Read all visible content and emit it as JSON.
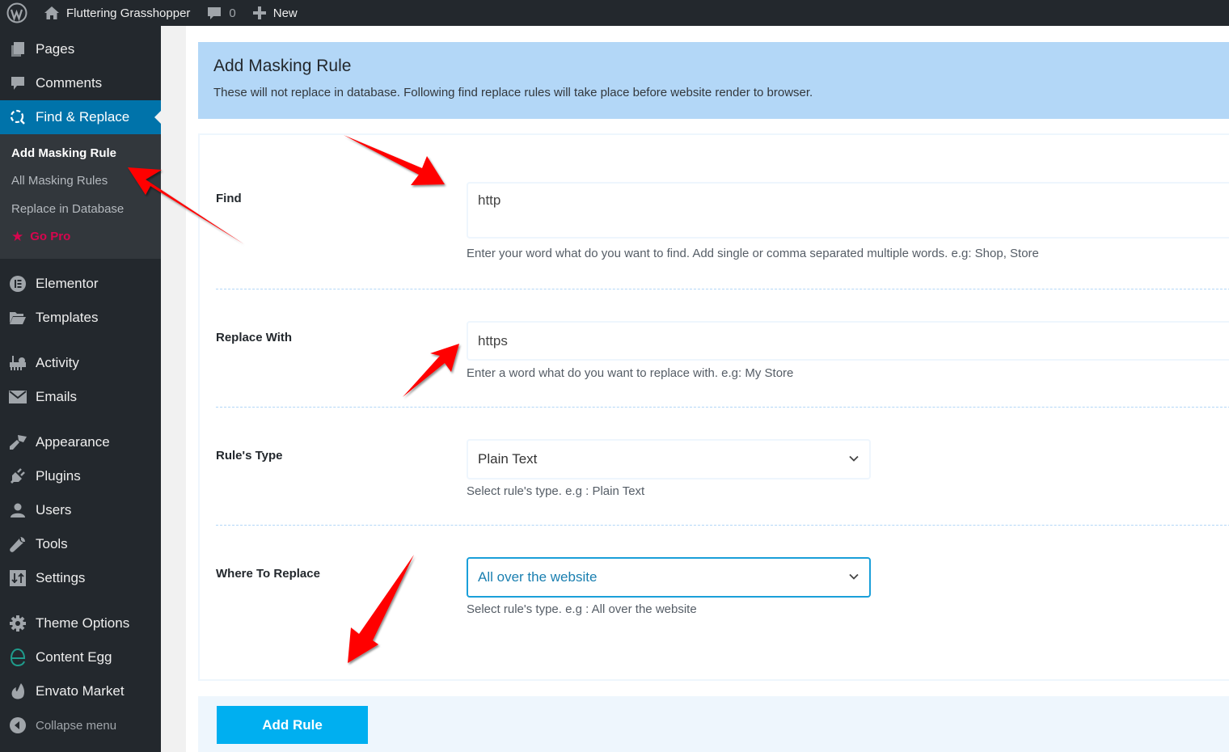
{
  "adminbar": {
    "site_name": "Fluttering Grasshopper",
    "comments_count": "0",
    "new_label": "New"
  },
  "sidebar": {
    "items_top": [
      {
        "label": "Pages",
        "icon": "pages-icon"
      },
      {
        "label": "Comments",
        "icon": "comments-icon"
      }
    ],
    "current": {
      "label": "Find & Replace",
      "icon": "find-replace-icon"
    },
    "submenu": [
      {
        "label": "Add Masking Rule",
        "current": true
      },
      {
        "label": "All Masking Rules"
      },
      {
        "label": "Replace in Database"
      },
      {
        "label": "Go Pro",
        "icon": "star-icon",
        "color": "#d7064e"
      }
    ],
    "group2": [
      {
        "label": "Elementor",
        "icon": "elementor-icon"
      },
      {
        "label": "Templates",
        "icon": "folder-icon"
      }
    ],
    "group3": [
      {
        "label": "Activity",
        "icon": "activity-icon"
      },
      {
        "label": "Emails",
        "icon": "email-icon"
      }
    ],
    "group4": [
      {
        "label": "Appearance",
        "icon": "paintbrush-icon"
      },
      {
        "label": "Plugins",
        "icon": "plugin-icon"
      },
      {
        "label": "Users",
        "icon": "user-icon"
      },
      {
        "label": "Tools",
        "icon": "wrench-icon"
      },
      {
        "label": "Settings",
        "icon": "settings-icon"
      }
    ],
    "group5": [
      {
        "label": "Theme Options",
        "icon": "gear-icon"
      },
      {
        "label": "Content Egg",
        "icon": "content-egg-icon"
      },
      {
        "label": "Envato Market",
        "icon": "envato-leaf-icon"
      }
    ],
    "collapse_label": "Collapse menu"
  },
  "notice": {
    "title": "Add Masking Rule",
    "text": "These will not replace in database. Following find replace rules will take place before website render to browser."
  },
  "form": {
    "find": {
      "label": "Find",
      "value": "http",
      "help": "Enter your word what do you want to find. Add single or comma separated multiple words. e.g: Shop, Store"
    },
    "replace": {
      "label": "Replace With",
      "value": "https",
      "help": "Enter a word what do you want to replace with. e.g: My Store"
    },
    "rule_type": {
      "label": "Rule's Type",
      "selected": "Plain Text",
      "help": "Select rule's type. e.g : Plain Text"
    },
    "where": {
      "label": "Where To Replace",
      "selected": "All over the website",
      "help": "Select rule's type. e.g : All over the website"
    },
    "submit_label": "Add Rule"
  },
  "colors": {
    "adminbar_bg": "#23282d",
    "menu_current": "#0073aa",
    "notice_bg": "#b3d7f7",
    "button_bg": "#00aff0",
    "annotation_arrow": "#ff0000",
    "gopro": "#d7064e"
  }
}
